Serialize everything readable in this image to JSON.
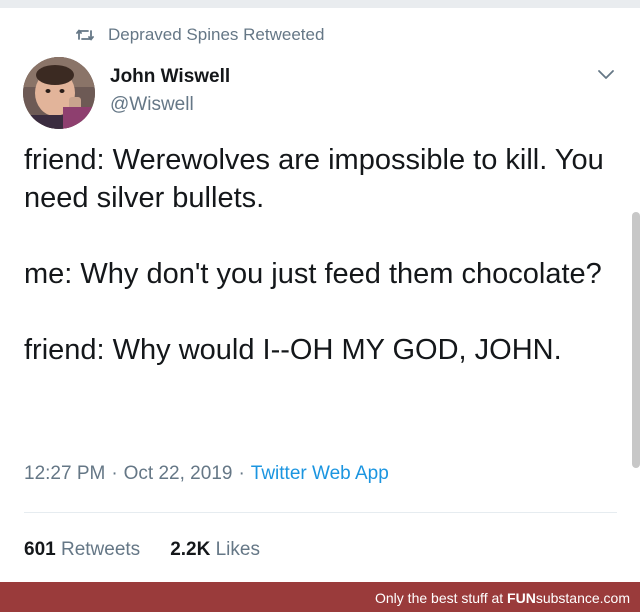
{
  "retweet": {
    "icon": "retweet-icon",
    "text": "Depraved Spines Retweeted"
  },
  "author": {
    "name": "John Wiswell",
    "handle": "@Wiswell"
  },
  "tweet": {
    "paragraphs": [
      "friend: Werewolves are impossible to kill. You need silver bullets.",
      "me: Why don't you just feed them chocolate?",
      "friend: Why would I--OH MY GOD, JOHN."
    ],
    "time": "12:27 PM",
    "separator": "·",
    "date": "Oct 22, 2019",
    "source": "Twitter Web App"
  },
  "stats": {
    "retweets_count": "601",
    "retweets_label": "Retweets",
    "likes_count": "2.2K",
    "likes_label": "Likes"
  },
  "footer": {
    "prefix": "Only the best stuff at ",
    "brand_bold": "FUN",
    "brand_rest": "substance",
    "suffix": ".com"
  },
  "colors": {
    "secondary_text": "#657786",
    "link": "#1b95e0",
    "footer_bg": "#9a3b3b"
  }
}
